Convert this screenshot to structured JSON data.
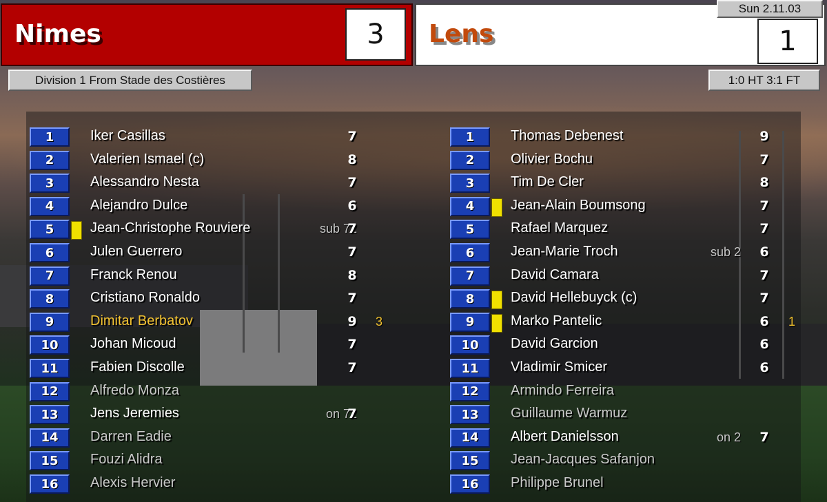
{
  "match": {
    "date": "Sun 2.11.03",
    "competition": "Division 1 From Stade des Costières",
    "scoreline": "1:0 HT 3:1 FT"
  },
  "home": {
    "name": "Nimes",
    "score": "3",
    "color": "#b30000",
    "players": [
      {
        "num": "1",
        "name": "Iker Casillas",
        "rating": "7",
        "note": "",
        "goals": "",
        "card": false,
        "style": "starter"
      },
      {
        "num": "2",
        "name": "Valerien Ismael (c)",
        "rating": "8",
        "note": "",
        "goals": "",
        "card": false,
        "style": "starter"
      },
      {
        "num": "3",
        "name": "Alessandro Nesta",
        "rating": "7",
        "note": "",
        "goals": "",
        "card": false,
        "style": "starter"
      },
      {
        "num": "4",
        "name": "Alejandro Dulce",
        "rating": "6",
        "note": "",
        "goals": "",
        "card": false,
        "style": "starter"
      },
      {
        "num": "5",
        "name": "Jean-Christophe Rouviere",
        "rating": "7",
        "note": "sub 72",
        "goals": "",
        "card": true,
        "style": "starter"
      },
      {
        "num": "6",
        "name": "Julen Guerrero",
        "rating": "7",
        "note": "",
        "goals": "",
        "card": false,
        "style": "starter"
      },
      {
        "num": "7",
        "name": "Franck Renou",
        "rating": "8",
        "note": "",
        "goals": "",
        "card": false,
        "style": "starter"
      },
      {
        "num": "8",
        "name": "Cristiano Ronaldo",
        "rating": "7",
        "note": "",
        "goals": "",
        "card": false,
        "style": "starter"
      },
      {
        "num": "9",
        "name": "Dimitar Berbatov",
        "rating": "9",
        "note": "",
        "goals": "3",
        "card": false,
        "style": "scorer"
      },
      {
        "num": "10",
        "name": "Johan Micoud",
        "rating": "7",
        "note": "",
        "goals": "",
        "card": false,
        "style": "starter"
      },
      {
        "num": "11",
        "name": "Fabien Discolle",
        "rating": "7",
        "note": "",
        "goals": "",
        "card": false,
        "style": "starter"
      },
      {
        "num": "12",
        "name": "Alfredo Monza",
        "rating": "",
        "note": "",
        "goals": "",
        "card": false,
        "style": "sub"
      },
      {
        "num": "13",
        "name": "Jens Jeremies",
        "rating": "7",
        "note": "on 72",
        "goals": "",
        "card": false,
        "style": "starter"
      },
      {
        "num": "14",
        "name": "Darren Eadie",
        "rating": "",
        "note": "",
        "goals": "",
        "card": false,
        "style": "sub"
      },
      {
        "num": "15",
        "name": "Fouzi Alidra",
        "rating": "",
        "note": "",
        "goals": "",
        "card": false,
        "style": "sub"
      },
      {
        "num": "16",
        "name": "Alexis Hervier",
        "rating": "",
        "note": "",
        "goals": "",
        "card": false,
        "style": "sub"
      }
    ]
  },
  "away": {
    "name": "Lens",
    "score": "1",
    "color": "#c24a0c",
    "players": [
      {
        "num": "1",
        "name": "Thomas Debenest",
        "rating": "9",
        "note": "",
        "goals": "",
        "card": false,
        "style": "starter"
      },
      {
        "num": "2",
        "name": "Olivier Bochu",
        "rating": "7",
        "note": "",
        "goals": "",
        "card": false,
        "style": "starter"
      },
      {
        "num": "3",
        "name": "Tim De Cler",
        "rating": "8",
        "note": "",
        "goals": "",
        "card": false,
        "style": "starter"
      },
      {
        "num": "4",
        "name": "Jean-Alain Boumsong",
        "rating": "7",
        "note": "",
        "goals": "",
        "card": true,
        "style": "starter"
      },
      {
        "num": "5",
        "name": "Rafael Marquez",
        "rating": "7",
        "note": "",
        "goals": "",
        "card": false,
        "style": "starter"
      },
      {
        "num": "6",
        "name": "Jean-Marie Troch",
        "rating": "6",
        "note": "sub 2",
        "goals": "",
        "card": false,
        "style": "starter"
      },
      {
        "num": "7",
        "name": "David Camara",
        "rating": "7",
        "note": "",
        "goals": "",
        "card": false,
        "style": "starter"
      },
      {
        "num": "8",
        "name": "David Hellebuyck (c)",
        "rating": "7",
        "note": "",
        "goals": "",
        "card": true,
        "style": "starter"
      },
      {
        "num": "9",
        "name": "Marko Pantelic",
        "rating": "6",
        "note": "",
        "goals": "1",
        "card": true,
        "style": "starter"
      },
      {
        "num": "10",
        "name": "David Garcion",
        "rating": "6",
        "note": "",
        "goals": "",
        "card": false,
        "style": "starter"
      },
      {
        "num": "11",
        "name": "Vladimir Smicer",
        "rating": "6",
        "note": "",
        "goals": "",
        "card": false,
        "style": "starter"
      },
      {
        "num": "12",
        "name": "Armindo Ferreira",
        "rating": "",
        "note": "",
        "goals": "",
        "card": false,
        "style": "sub"
      },
      {
        "num": "13",
        "name": "Guillaume Warmuz",
        "rating": "",
        "note": "",
        "goals": "",
        "card": false,
        "style": "sub"
      },
      {
        "num": "14",
        "name": "Albert Danielsson",
        "rating": "7",
        "note": "on 2",
        "goals": "",
        "card": false,
        "style": "starter"
      },
      {
        "num": "15",
        "name": "Jean-Jacques Safanjon",
        "rating": "",
        "note": "",
        "goals": "",
        "card": false,
        "style": "sub"
      },
      {
        "num": "16",
        "name": "Philippe Brunel",
        "rating": "",
        "note": "",
        "goals": "",
        "card": false,
        "style": "sub"
      }
    ]
  }
}
